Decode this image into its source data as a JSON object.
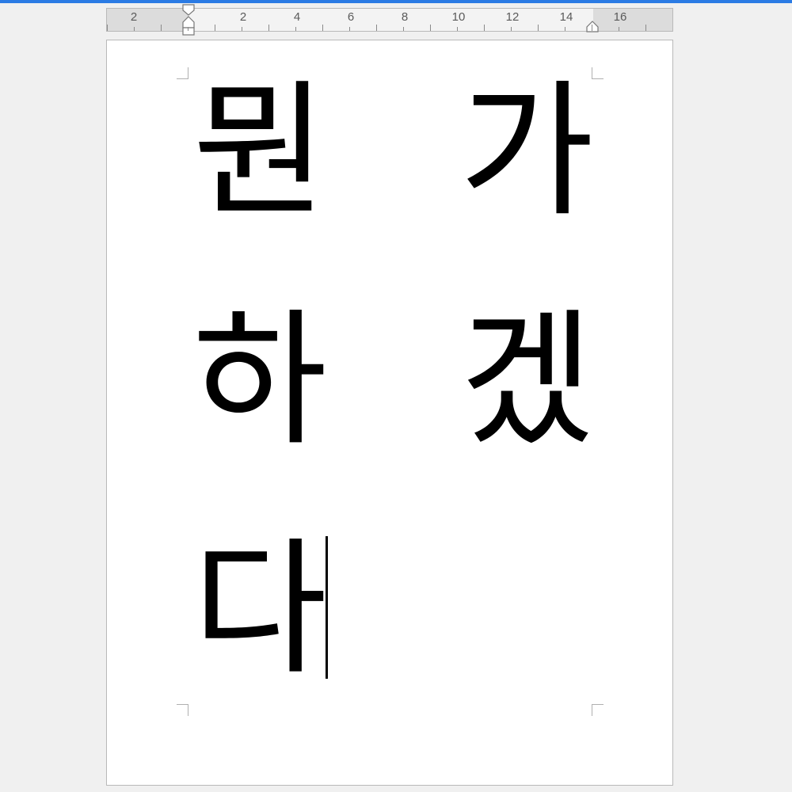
{
  "ruler": {
    "labels": [
      "2",
      "2",
      "4",
      "6",
      "8",
      "10",
      "12",
      "14",
      "16"
    ]
  },
  "document": {
    "characters": [
      "뭔",
      "가",
      "하",
      "겠",
      "다"
    ]
  }
}
